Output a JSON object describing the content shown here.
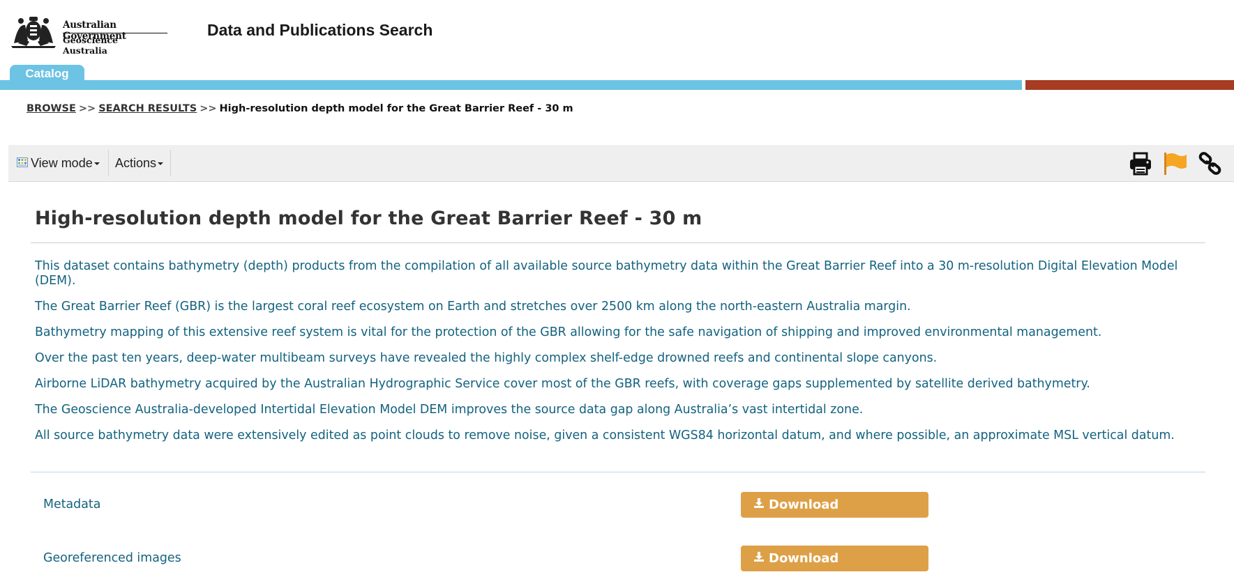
{
  "header": {
    "gov_name": "Australian Government",
    "agency_name": "Geoscience Australia",
    "site_title": "Data and Publications Search"
  },
  "tabs": [
    {
      "label": "Catalog",
      "active": true
    }
  ],
  "breadcrumb": {
    "browse": "BROWSE",
    "separator": ">>",
    "search_results": "SEARCH RESULTS",
    "current": "High-resolution depth model for the Great Barrier Reef - 30 m"
  },
  "toolbar": {
    "view_mode_label": "View mode",
    "actions_label": "Actions",
    "icons": [
      "print-icon",
      "flag-icon",
      "link-icon"
    ]
  },
  "record": {
    "title": "High-resolution depth model for the Great Barrier Reef - 30 m",
    "abstract": [
      "This dataset contains bathymetry (depth) products from the compilation of all available source bathymetry data within the Great Barrier Reef into a 30 m-resolution Digital Elevation Model (DEM).",
      "The Great Barrier Reef (GBR) is the largest coral reef ecosystem on Earth and stretches over 2500 km along the north-eastern Australia margin.",
      "Bathymetry mapping of this extensive reef system is vital for the protection of the GBR allowing for the safe navigation of shipping and improved environmental management.",
      "Over the past ten years, deep-water multibeam surveys have revealed the highly complex shelf-edge drowned reefs and continental slope canyons.",
      "Airborne LiDAR bathymetry acquired by the Australian Hydrographic Service cover most of the GBR reefs, with coverage gaps supplemented by satellite derived bathymetry.",
      "The Geoscience Australia-developed Intertidal Elevation Model DEM improves the source data gap along Australia’s vast intertidal zone.",
      "All source bathymetry data were extensively edited as point clouds to remove noise, given a consistent WGS84 horizontal datum, and where possible, an approximate MSL vertical datum."
    ],
    "resources": [
      {
        "label": "Metadata",
        "button": "Download"
      },
      {
        "label": "Georeferenced images",
        "button": "Download"
      }
    ]
  },
  "colors": {
    "tab_blue": "#6cc3e4",
    "bar_red": "#a63c22",
    "text_teal": "#13627f",
    "download_orange": "#dea047",
    "flag_orange": "#f5a623"
  }
}
